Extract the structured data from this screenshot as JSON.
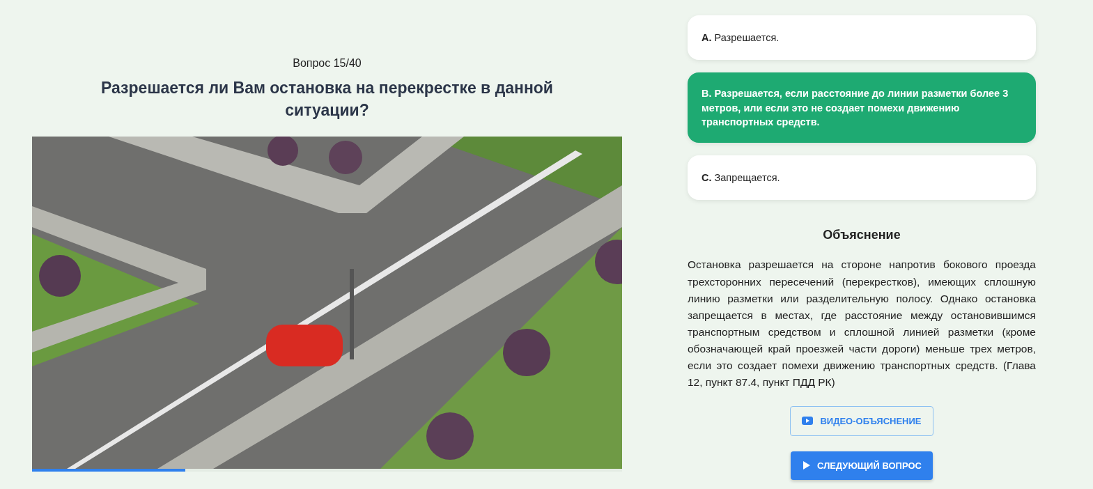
{
  "question": {
    "counter": "Вопрос 15/40",
    "text": "Разрешается ли Вам остановка на перекрестке в данной ситуации?"
  },
  "media": {
    "kind": "picture",
    "progress": {
      "level": 0.26
    }
  },
  "answers": [
    {
      "letter": "A.",
      "text": "Разрешается.",
      "selected": false
    },
    {
      "letter": "B.",
      "text": "Разрешается, если расстояние до линии разметки более 3 метров, или если это не создает помехи движению транспортных средств.",
      "selected": true
    },
    {
      "letter": "C.",
      "text": "Запрещается.",
      "selected": false
    }
  ],
  "explanation": {
    "title": "Объяснение",
    "text": "Остановка разрешается на стороне напротив бокового проезда трехсторонних пересечений (перекрестков), имеющих сплошную линию разметки или разделительную полосу. Однако остановка запрещается в местах, где расстояние между остановившимся транспортным средством и сплошной линией разметки (кроме обозначающей край проезжей части дороги) меньше трех метров, если это создает помехи движению транспортных средств. (Глава 12, пункт 87.4, пункт ПДД РК)"
  },
  "buttons": [
    {
      "kind": "video",
      "label": "ВИДЕО-ОБЪЯСНЕНИЕ"
    },
    {
      "kind": "next",
      "label": "СЛЕДУЮЩИЙ ВОПРОС"
    }
  ]
}
